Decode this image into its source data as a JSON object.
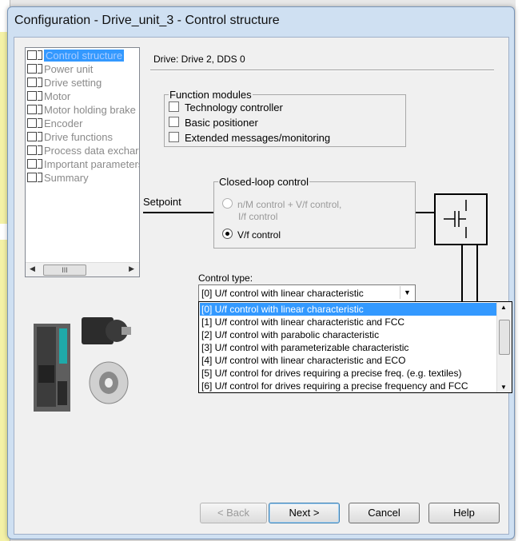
{
  "window": {
    "title": "Configuration - Drive_unit_3 - Control structure"
  },
  "tree": {
    "items": [
      {
        "label": "Control structure",
        "selected": true
      },
      {
        "label": "Power unit"
      },
      {
        "label": "Drive setting"
      },
      {
        "label": "Motor"
      },
      {
        "label": "Motor holding brake"
      },
      {
        "label": "Encoder"
      },
      {
        "label": "Drive functions"
      },
      {
        "label": "Process data exchar"
      },
      {
        "label": "Important parameters"
      },
      {
        "label": "Summary"
      }
    ],
    "scroll_thumb": "III"
  },
  "drive_label": "Drive: Drive  2, DDS 0",
  "function_modules": {
    "title": "Function modules",
    "options": [
      {
        "label": "Technology controller",
        "checked": false
      },
      {
        "label": "Basic positioner",
        "checked": false
      },
      {
        "label": "Extended messages/monitoring",
        "checked": false
      }
    ]
  },
  "closed_loop": {
    "title": "Closed-loop control",
    "options": [
      {
        "label_line1": "n/M control + V/f control,",
        "label_line2": "I/f control",
        "enabled": false,
        "selected": false
      },
      {
        "label": "V/f control",
        "enabled": true,
        "selected": true
      }
    ]
  },
  "setpoint_label": "Setpoint",
  "control_type": {
    "label": "Control type:",
    "selected_value": "[0] U/f control with linear characteristic",
    "options": [
      "[0] U/f control with linear characteristic",
      "[1] U/f control with linear characteristic and FCC",
      "[2] U/f control with parabolic characteristic",
      "[3] U/f control with parameterizable characteristic",
      "[4] U/f control with linear characteristic and ECO",
      "[5] U/f control for drives requiring a precise freq. (e.g. textiles)",
      "[6] U/f control for drives requiring a precise frequency and FCC"
    ],
    "highlighted_index": 0
  },
  "buttons": {
    "back": "< Back",
    "next": "Next >",
    "cancel": "Cancel",
    "help": "Help"
  },
  "colors": {
    "selection": "#3399ff",
    "window_frame": "#cfe0f2",
    "dialog_bg": "#f0f0f0"
  },
  "icons": [
    "checkbox-icon",
    "node-icon",
    "motor-icon",
    "drive-module-icon",
    "switch-symbol-icon",
    "dropdown-arrow-icon",
    "scroll-up-icon",
    "scroll-down-icon"
  ]
}
